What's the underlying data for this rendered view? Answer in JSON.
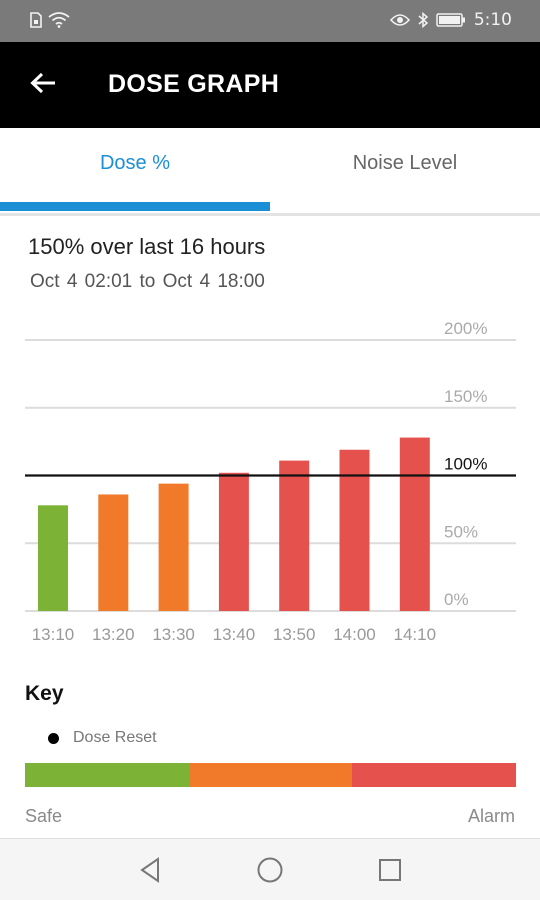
{
  "status_bar": {
    "time": "5:10",
    "icons": [
      "sim-icon",
      "wifi-icon",
      "eye-icon",
      "bluetooth-icon",
      "battery-icon"
    ]
  },
  "app_bar": {
    "title": "DOSE GRAPH",
    "back_icon": "arrow-left-icon"
  },
  "tabs": [
    {
      "label": "Dose %",
      "active": true
    },
    {
      "label": "Noise Level",
      "active": false
    }
  ],
  "summary": {
    "headline": "150% over last 16 hours",
    "range": "Oct 4   02:01 to Oct 4   18:00"
  },
  "chart_data": {
    "type": "bar",
    "categories": [
      "13:10",
      "13:20",
      "13:30",
      "13:40",
      "13:50",
      "14:00",
      "14:10"
    ],
    "values": [
      78,
      86,
      94,
      102,
      111,
      119,
      128
    ],
    "colors": [
      "#7cb336",
      "#f07a2a",
      "#f07a2a",
      "#e5524e",
      "#e5524e",
      "#e5524e",
      "#e5524e"
    ],
    "y_ticks": [
      "0%",
      "50%",
      "100%",
      "150%",
      "200%"
    ],
    "ylim": [
      0,
      200
    ],
    "reference_line": 100,
    "grid": true
  },
  "key": {
    "title": "Key",
    "items": [
      {
        "label": "Dose Reset",
        "marker": "dot"
      }
    ],
    "scale_colors": [
      "#7cb336",
      "#f07a2a",
      "#e5524e"
    ],
    "scale_min_label": "Safe",
    "scale_max_label": "Alarm"
  },
  "nav_bar": {
    "icons": [
      "back-triangle-icon",
      "home-circle-icon",
      "recents-square-icon"
    ]
  }
}
